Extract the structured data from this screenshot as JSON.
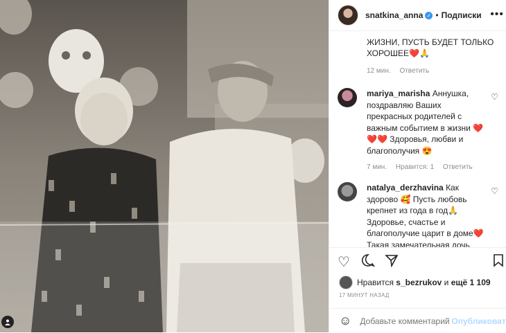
{
  "post": {
    "username": "snatkina_anna",
    "dot": "•",
    "follow_label": "Подписки",
    "menu_label": "•••"
  },
  "first_comment": {
    "text_line1": "ЖИЗНИ, ПУСТЬ БУДЕТ ТОЛЬКО",
    "text_line2": "ХОРОШЕЕ❤️🙏",
    "time": "12 мин.",
    "reply_label": "Ответить"
  },
  "comments": [
    {
      "username": "mariya_marisha",
      "text": "Аннушка, поздравляю Ваших прекрасных родителей с важным событием в жизни ❤️❤️❤️ Здоровья, любви и благополучия 😍",
      "time": "7 мин.",
      "likes": "Нравится: 1",
      "reply_label": "Ответить"
    },
    {
      "username": "natalya_derzhavina",
      "text": "Как здорово 🥰 Пусть любовь крепнет из года в год🙏 Здоровье, счастье и благополучие царит в доме❤️ Такая замечательная дочь может быть только у замечательных людей☺️🤗"
    }
  ],
  "likes": {
    "prefix": "Нравится",
    "user": "s_bezrukov",
    "suffix": "и",
    "others": "ещё 1 109"
  },
  "time_ago": "17 МИНУТ НАЗАД",
  "comment_input": {
    "placeholder": "Добавьте комментарий...",
    "publish_label": "Опубликовать"
  },
  "icons": [
    "heart-icon",
    "comment-icon",
    "share-icon",
    "bookmark-icon",
    "emoji-icon",
    "more-icon",
    "verified-icon",
    "user-tag-icon"
  ],
  "colors": {
    "accent": "#3897f0",
    "publish": "#b3dbff",
    "muted": "#8e8e8e"
  }
}
